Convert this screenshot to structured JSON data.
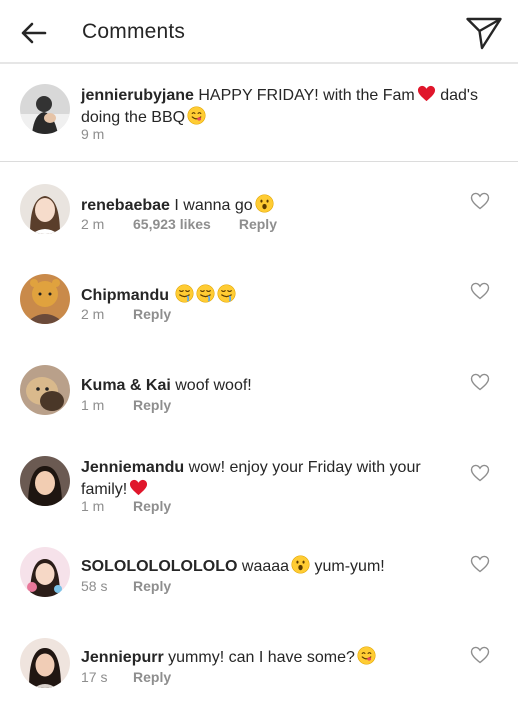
{
  "header": {
    "back_icon": "arrow-left-icon",
    "title": "Comments",
    "send_icon": "paper-plane-icon"
  },
  "caption": {
    "username": "jennierubyjane",
    "text_before_emoji": "HAPPY FRIDAY! with the Fam",
    "emoji_1": "red-heart-emoji",
    "text_after_emoji": "dad's doing the BBQ",
    "emoji_2": "yum-face-emoji",
    "time": "9 m"
  },
  "comments": [
    {
      "username": "renebaebae",
      "text": "I wanna go",
      "emoji": "surprised-face-emoji",
      "time": "2 m",
      "likes": "65,923 likes",
      "reply": "Reply"
    },
    {
      "username": "Chipmandu",
      "text": "",
      "emoji": "drooling-face-emoji x3",
      "time": "2 m",
      "reply": "Reply"
    },
    {
      "username": "Kuma & Kai",
      "text": "woof woof!",
      "time": "1 m",
      "reply": "Reply"
    },
    {
      "username": "Jenniemandu",
      "text": "wow! enjoy your Friday with your family!",
      "emoji": "red-heart-emoji",
      "time": "1 m",
      "reply": "Reply"
    },
    {
      "username": "SOLOLOLOLOLOLO",
      "text_before_emoji": "waaaa",
      "emoji": "surprised-face-emoji",
      "text_after_emoji": "yum-yum!",
      "time": "58 s",
      "reply": "Reply"
    },
    {
      "username": "Jenniepurr",
      "text": "yummy! can I have some?",
      "emoji": "yum-face-emoji",
      "time": "17 s",
      "reply": "Reply"
    }
  ],
  "colors": {
    "text": "#262626",
    "meta": "#8e8e8e",
    "heart_red": "#e0162b",
    "divider": "#dcdcdc"
  }
}
